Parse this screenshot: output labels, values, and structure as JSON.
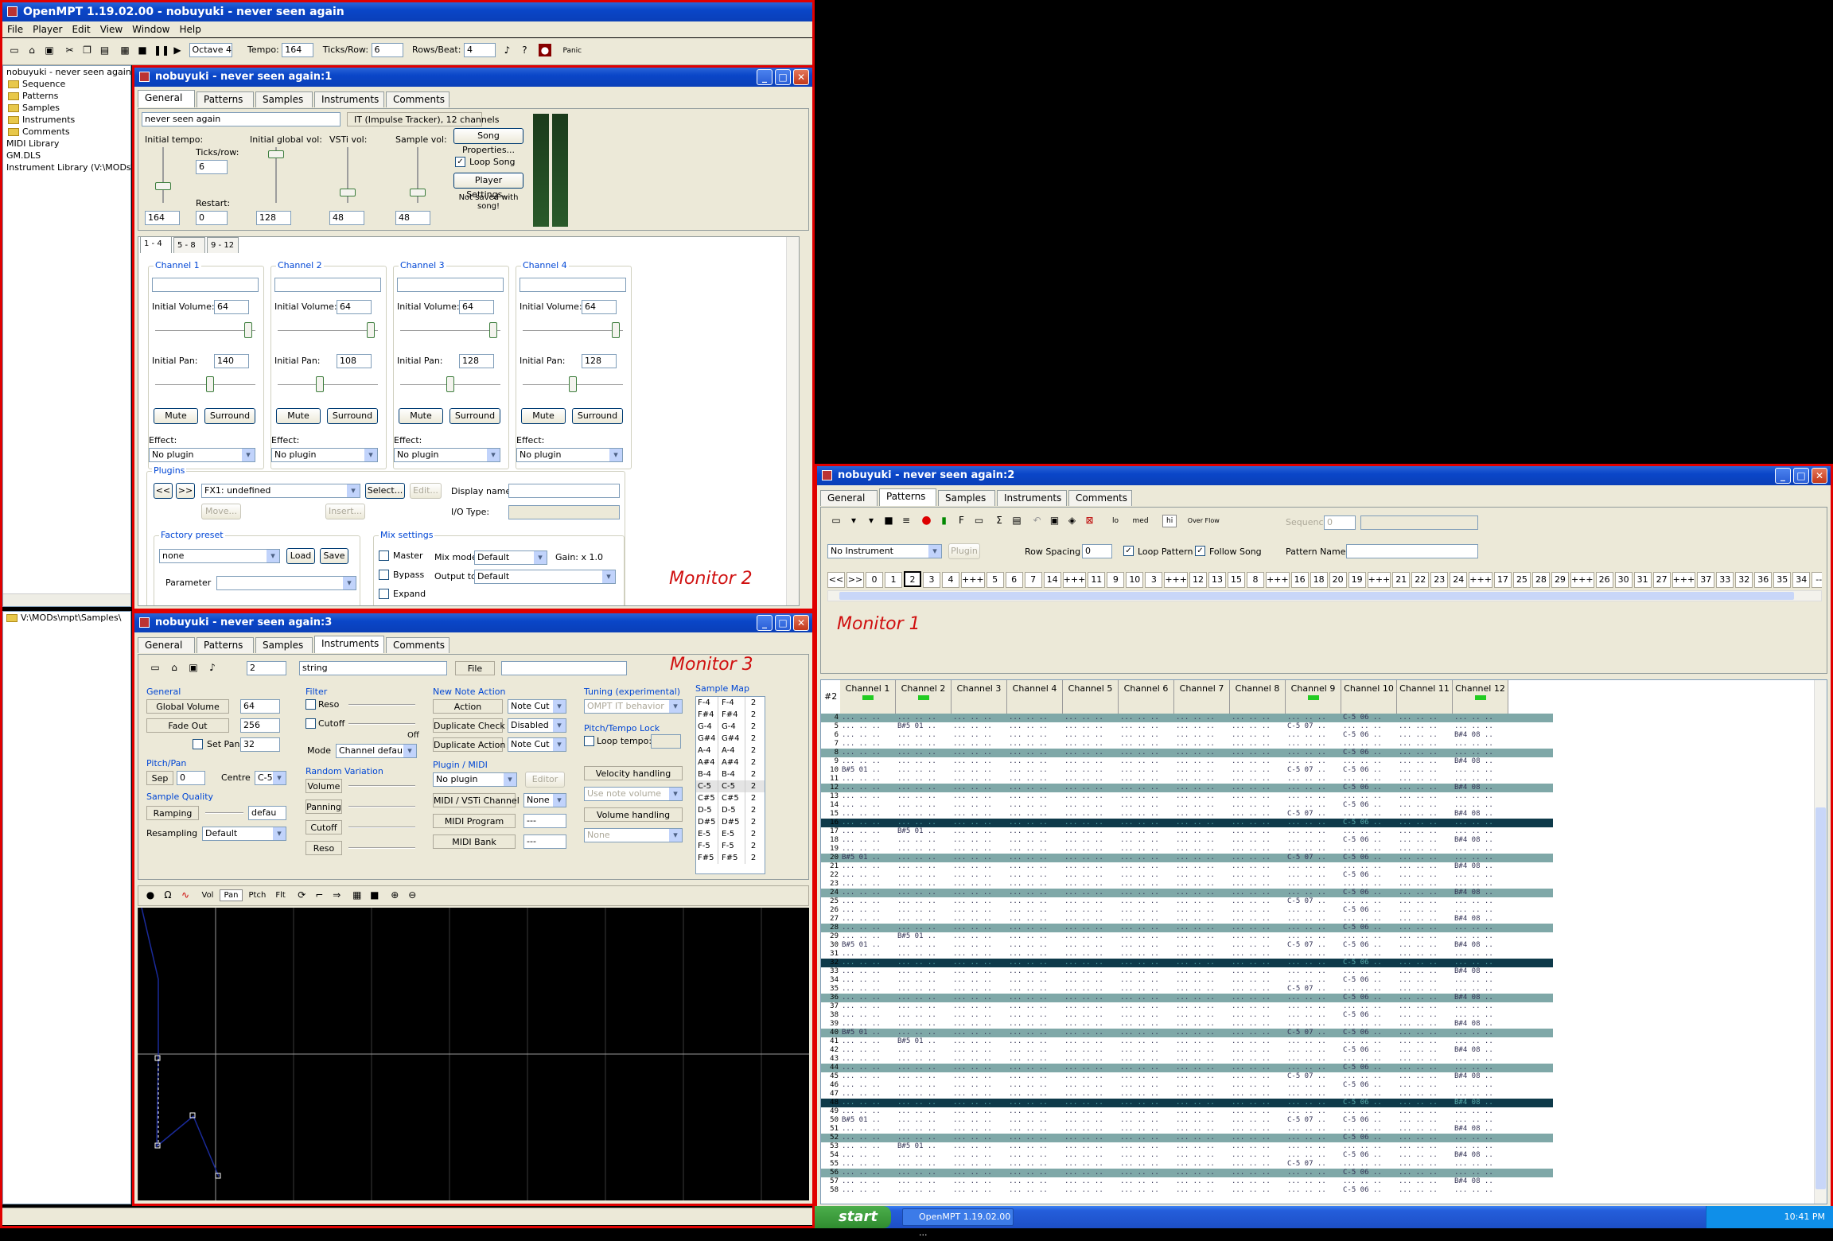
{
  "main": {
    "title": "OpenMPT 1.19.02.00 - nobuyuki - never seen again",
    "menu": [
      "File",
      "Player",
      "Edit",
      "View",
      "Window",
      "Help"
    ],
    "toolbar": {
      "octave": "Octave 4",
      "tempo_label": "Tempo:",
      "tempo": "164",
      "ticks_label": "Ticks/Row:",
      "ticks": "6",
      "rows_label": "Rows/Beat:",
      "rows": "4",
      "panic": "Panic"
    },
    "tree": {
      "root": "nobuyuki - never seen again",
      "items": [
        "Sequence",
        "Patterns",
        "Samples",
        "Instruments",
        "Comments"
      ],
      "extra": [
        "MIDI Library",
        "GM.DLS",
        "Instrument Library (V:\\MODs\\mp"
      ],
      "samples_path": "V:\\MODs\\mpt\\Samples\\"
    }
  },
  "win1": {
    "title": "nobuyuki - never seen again:1",
    "tabs": [
      "General",
      "Patterns",
      "Samples",
      "Instruments",
      "Comments"
    ],
    "song_name": "never seen again",
    "format": "IT (Impulse Tracker), 12 channels",
    "initial_tempo_label": "Initial tempo:",
    "ticks_label": "Ticks/row:",
    "ticks": "6",
    "restart_label": "Restart:",
    "restart": "0",
    "tempo": "164",
    "global_vol_label": "Initial global vol:",
    "global_vol": "128",
    "vsti_label": "VSTi vol:",
    "vsti": "48",
    "sample_vol_label": "Sample vol:",
    "sample_vol": "48",
    "song_props": "Song Properties...",
    "loop_song": "Loop Song",
    "player_settings": "Player Settings...",
    "not_saved": "Not saved with song!",
    "chtabs": [
      "1 - 4",
      "5 - 8",
      "9 - 12"
    ],
    "channels": [
      {
        "name": "Channel 1",
        "vol": "64",
        "pan": "140"
      },
      {
        "name": "Channel 2",
        "vol": "64",
        "pan": "108"
      },
      {
        "name": "Channel 3",
        "vol": "64",
        "pan": "128"
      },
      {
        "name": "Channel 4",
        "vol": "64",
        "pan": "128"
      }
    ],
    "initial_volume": "Initial Volume:",
    "initial_pan": "Initial Pan:",
    "mute": "Mute",
    "surround": "Surround",
    "effect": "Effect:",
    "no_plugin": "No plugin",
    "plugins_label": "Plugins",
    "fx": "FX1: undefined",
    "select": "Select...",
    "edit": "Edit...",
    "display_name": "Display name",
    "move": "Move...",
    "insert": "Insert...",
    "io_type": "I/O Type:",
    "factory_preset": "Factory preset",
    "preset": "none",
    "load": "Load",
    "save": "Save",
    "parameter": "Parameter",
    "mix_settings": "Mix settings",
    "master": "Master",
    "bypass": "Bypass",
    "expand": "Expand",
    "mix_mode_label": "Mix mode",
    "mix_mode": "Default",
    "gain": "Gain: x 1.0",
    "output_to_label": "Output to",
    "output_to": "Default",
    "prev": "<<",
    "next": ">>"
  },
  "win3": {
    "title": "nobuyuki - never seen again:3",
    "instrument_num": "2",
    "instrument_name": "string",
    "file_label": "File",
    "general": "General",
    "global_volume": "Global Volume",
    "global_volume_val": "64",
    "fade_out": "Fade Out",
    "fade_out_val": "256",
    "set_pan": "Set Pan",
    "set_pan_val": "32",
    "pitch_pan": "Pitch/Pan",
    "sep": "Sep",
    "sep_val": "0",
    "centre": "Centre",
    "centre_val": "C-5",
    "sample_quality": "Sample Quality",
    "ramping": "Ramping",
    "ramping_val": "defau",
    "resampling": "Resampling",
    "resampling_val": "Default",
    "filter": "Filter",
    "reso": "Reso",
    "cutoff": "Cutoff",
    "off": "Off",
    "mode": "Mode",
    "mode_val": "Channel default",
    "random_variation": "Random Variation",
    "volume": "Volume",
    "panning": "Panning",
    "new_note_action": "New Note Action",
    "action": "Action",
    "action_val": "Note Cut",
    "dup_check": "Duplicate Check",
    "dup_check_val": "Disabled",
    "dup_action": "Duplicate Action",
    "dup_action_val": "Note Cut",
    "plugin_midi": "Plugin / MIDI",
    "plugin_val": "No plugin",
    "editor": "Editor",
    "midi_channel": "MIDI / VSTi Channel",
    "midi_channel_val": "None",
    "midi_program": "MIDI Program",
    "midi_program_val": "---",
    "midi_bank": "MIDI Bank",
    "midi_bank_val": "---",
    "tuning": "Tuning (experimental)",
    "tuning_val": "OMPT IT behavior",
    "pitch_tempo_lock": "Pitch/Tempo Lock",
    "loop_tempo": "Loop tempo:",
    "velocity_handling": "Velocity handling",
    "use_note_volume": "Use note volume",
    "volume_handling": "Volume handling",
    "none": "None",
    "sample_map": "Sample Map",
    "map": [
      [
        "F-4",
        "F-4",
        "2"
      ],
      [
        "F#4",
        "F#4",
        "2"
      ],
      [
        "G-4",
        "G-4",
        "2"
      ],
      [
        "G#4",
        "G#4",
        "2"
      ],
      [
        "A-4",
        "A-4",
        "2"
      ],
      [
        "A#4",
        "A#4",
        "2"
      ],
      [
        "B-4",
        "B-4",
        "2"
      ],
      [
        "C-5",
        "C-5",
        "2"
      ],
      [
        "C#5",
        "C#5",
        "2"
      ],
      [
        "D-5",
        "D-5",
        "2"
      ],
      [
        "D#5",
        "D#5",
        "2"
      ],
      [
        "E-5",
        "E-5",
        "2"
      ],
      [
        "F-5",
        "F-5",
        "2"
      ],
      [
        "F#5",
        "F#5",
        "2"
      ]
    ],
    "env_tabs": [
      "Vol",
      "Pan",
      "Ptch",
      "Flt"
    ]
  },
  "win2": {
    "title": "nobuyuki - never seen again:2",
    "instrument": "No Instrument",
    "plugin": "Plugin",
    "row_spacing": "Row Spacing",
    "row_spacing_val": "0",
    "loop_pattern": "Loop Pattern",
    "follow_song": "Follow Song",
    "sequence_label": "Sequence",
    "sequence_val": "0",
    "pattern_name": "Pattern Name",
    "tb_lo": "lo",
    "tb_med": "med",
    "tb_hi": "hi",
    "tb_over": "Over Flow",
    "sequence": [
      "<<",
      ">>",
      "0",
      "1",
      "2",
      "3",
      "4",
      "+++",
      "5",
      "6",
      "7",
      "14",
      "+++",
      "11",
      "9",
      "10",
      "3",
      "+++",
      "12",
      "13",
      "15",
      "8",
      "+++",
      "16",
      "18",
      "20",
      "19",
      "+++",
      "21",
      "22",
      "23",
      "24",
      "+++",
      "17",
      "25",
      "28",
      "29",
      "+++",
      "26",
      "30",
      "31",
      "27",
      "+++",
      "37",
      "33",
      "32",
      "36",
      "35",
      "34",
      "---",
      "..."
    ],
    "pattern_num": "#2",
    "channels": [
      "Channel 1",
      "Channel 2",
      "Channel 3",
      "Channel 4",
      "Channel 5",
      "Channel 6",
      "Channel 7",
      "Channel 8",
      "Channel 9",
      "Channel 10",
      "Channel 11",
      "Channel 12"
    ],
    "row_start": 4,
    "row_end": 58
  },
  "labels": {
    "monitor1": "Monitor 1",
    "monitor2": "Monitor 2",
    "monitor3": "Monitor 3"
  },
  "taskbar": {
    "start": "start",
    "task": "OpenMPT 1.19.02.00 ...",
    "clock": "10:41 PM"
  },
  "colors": {
    "title_bar": "#0a46c8",
    "frame": "#e00000",
    "face": "#ece9d8",
    "pattern_bg": "#ffffff",
    "pattern_hl": "#7fa8a8",
    "pattern_dark": "#0e3a4a"
  }
}
